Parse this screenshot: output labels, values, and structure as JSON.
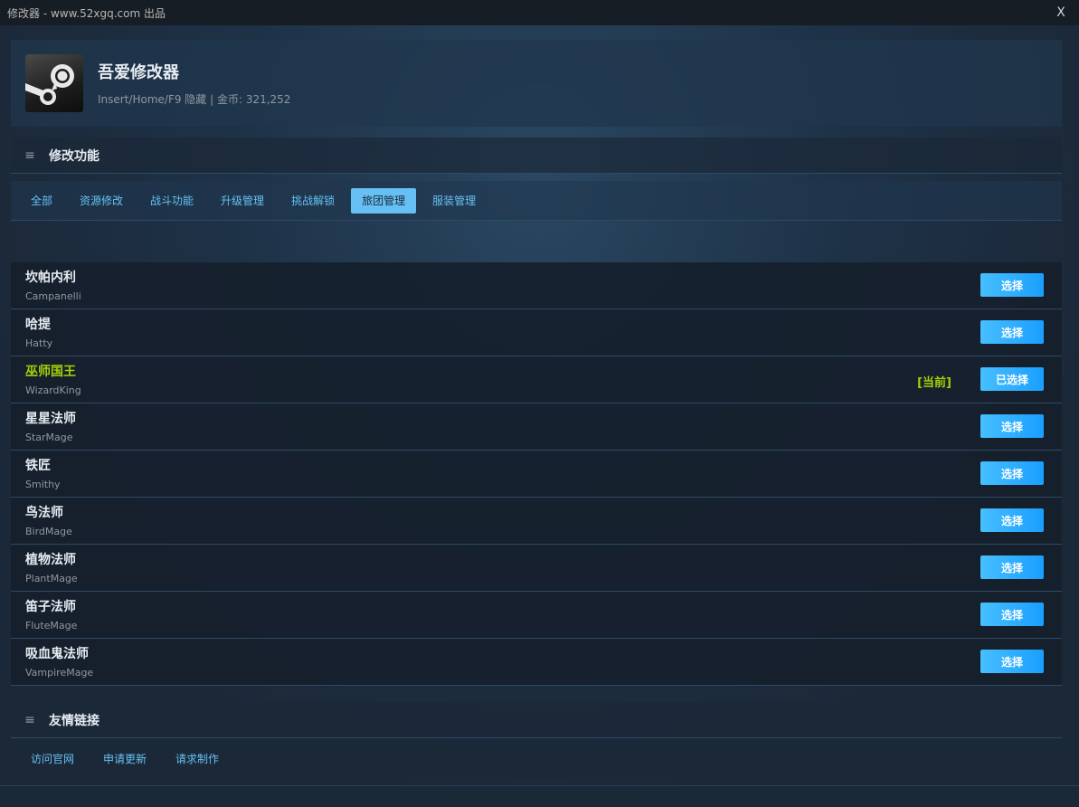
{
  "window": {
    "title": "修改器 - www.52xgq.com 出品",
    "close_label": "X"
  },
  "header": {
    "app_name": "吾爱修改器",
    "subtitle": "Insert/Home/F9 隐藏 | 金币: 321,252"
  },
  "features_section": {
    "icon": "≡",
    "title": "修改功能"
  },
  "tabs": [
    {
      "label": "全部"
    },
    {
      "label": "资源修改"
    },
    {
      "label": "战斗功能"
    },
    {
      "label": "升级管理"
    },
    {
      "label": "挑战解锁"
    },
    {
      "label": "旅团管理"
    },
    {
      "label": "服装管理"
    }
  ],
  "active_tab": "旅团管理",
  "rows": [
    {
      "name": "坎帕内利",
      "sub": "Campanelli",
      "button": "选择"
    },
    {
      "name": "哈提",
      "sub": "Hatty",
      "button": "选择"
    },
    {
      "name": "巫师国王",
      "sub": "WizardKing",
      "button": "已选择",
      "tag": "[当前]"
    },
    {
      "name": "星星法师",
      "sub": "StarMage",
      "button": "选择"
    },
    {
      "name": "铁匠",
      "sub": "Smithy",
      "button": "选择"
    },
    {
      "name": "鸟法师",
      "sub": "BirdMage",
      "button": "选择"
    },
    {
      "name": "植物法师",
      "sub": "PlantMage",
      "button": "选择"
    },
    {
      "name": "笛子法师",
      "sub": "FluteMage",
      "button": "选择"
    },
    {
      "name": "吸血鬼法师",
      "sub": "VampireMage",
      "button": "选择"
    }
  ],
  "links_section": {
    "icon": "≡",
    "title": "友情链接",
    "links": [
      {
        "label": "访问官网"
      },
      {
        "label": "申请更新"
      },
      {
        "label": "请求制作"
      }
    ]
  },
  "colors": {
    "accent": "#66c0f4",
    "current": "#a4d007",
    "button": "#1a9fff"
  },
  "icons": {
    "logo": "steam-logo-icon"
  }
}
